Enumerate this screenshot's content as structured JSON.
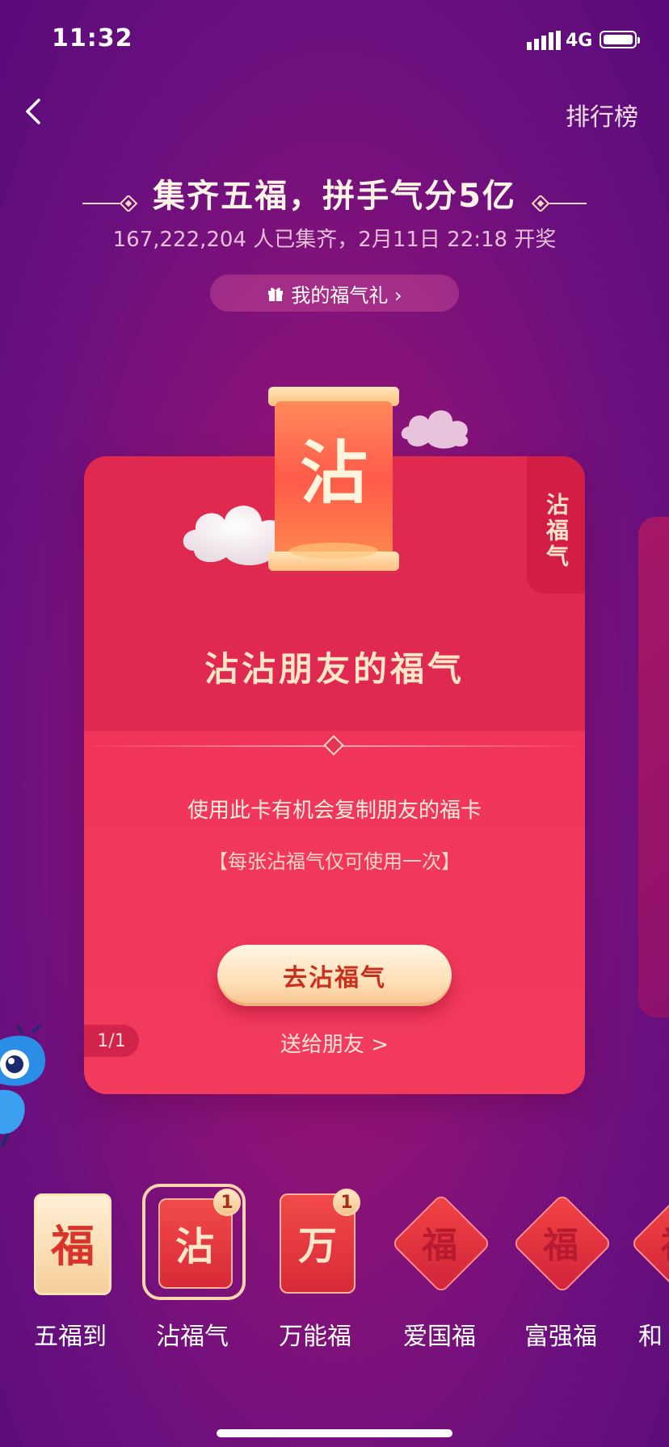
{
  "status_bar": {
    "time": "11:32",
    "network": "4G"
  },
  "nav": {
    "ranking": "排行榜"
  },
  "header": {
    "title": "集齐五福，拼手气分5亿",
    "subtitle": "167,222,204 人已集齐，2月11日 22:18 开奖",
    "gift_link": "我的福气礼 ›"
  },
  "card": {
    "emblem_char": "沾",
    "side_tag": "沾福气",
    "title": "沾沾朋友的福气",
    "description": "使用此卡有机会复制朋友的福卡",
    "note": "【每张沾福气仅可使用一次】",
    "action_button": "去沾福气",
    "send_link": "送给朋友 >",
    "page_indicator": "1/1"
  },
  "fu_cards": [
    {
      "label": "五福到",
      "glyph": "福",
      "count": null,
      "selected": false
    },
    {
      "label": "沾福气",
      "glyph": "沾",
      "count": "1",
      "selected": true
    },
    {
      "label": "万能福",
      "glyph": "万",
      "count": "1",
      "selected": false
    },
    {
      "label": "爱国福",
      "glyph": "福",
      "count": null,
      "selected": false
    },
    {
      "label": "富强福",
      "glyph": "福",
      "count": null,
      "selected": false
    },
    {
      "label": "和",
      "glyph": "福",
      "count": null,
      "selected": false
    }
  ],
  "colors": {
    "background": "#8a1378",
    "card_red": "#e0294f",
    "gold_text": "#ffe6c6",
    "button_text": "#c7301d"
  }
}
